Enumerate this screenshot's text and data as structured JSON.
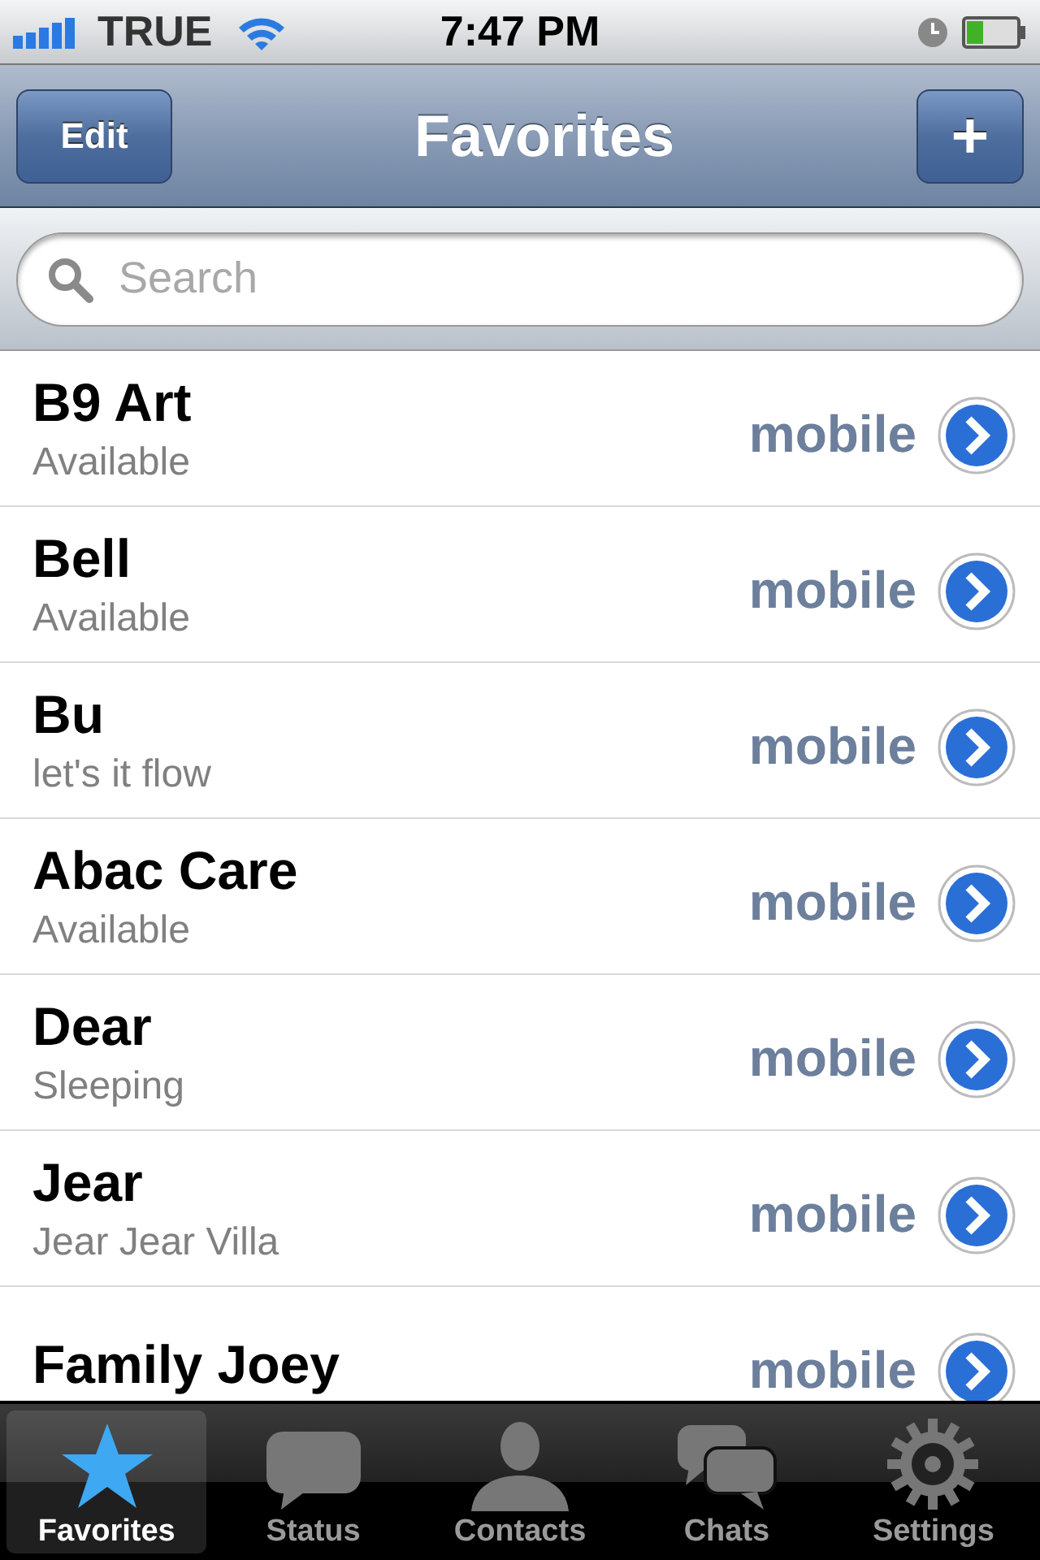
{
  "status_bar": {
    "carrier": "TRUE",
    "time": "7:47 PM"
  },
  "nav_bar": {
    "title": "Favorites",
    "left_button": "Edit",
    "right_button": "+"
  },
  "search": {
    "placeholder": "Search"
  },
  "contacts": [
    {
      "name": "B9 Art",
      "status": "Available",
      "phone_type": "mobile"
    },
    {
      "name": "Bell",
      "status": "Available",
      "phone_type": "mobile"
    },
    {
      "name": "Bu",
      "status": "let's it flow",
      "phone_type": "mobile"
    },
    {
      "name": "Abac Care",
      "status": "Available",
      "phone_type": "mobile"
    },
    {
      "name": "Dear",
      "status": "Sleeping",
      "phone_type": "mobile"
    },
    {
      "name": "Jear",
      "status": "Jear Jear Villa",
      "phone_type": "mobile"
    },
    {
      "name": "Family Joey",
      "phone_type": "mobile"
    }
  ],
  "tab_bar": [
    {
      "label": "Favorites",
      "kind": "star",
      "selected": true
    },
    {
      "label": "Status",
      "kind": "bubble",
      "selected": false
    },
    {
      "label": "Contacts",
      "kind": "person",
      "selected": false
    },
    {
      "label": "Chats",
      "kind": "bubbles",
      "selected": false
    },
    {
      "label": "Settings",
      "kind": "gear",
      "selected": false
    }
  ]
}
